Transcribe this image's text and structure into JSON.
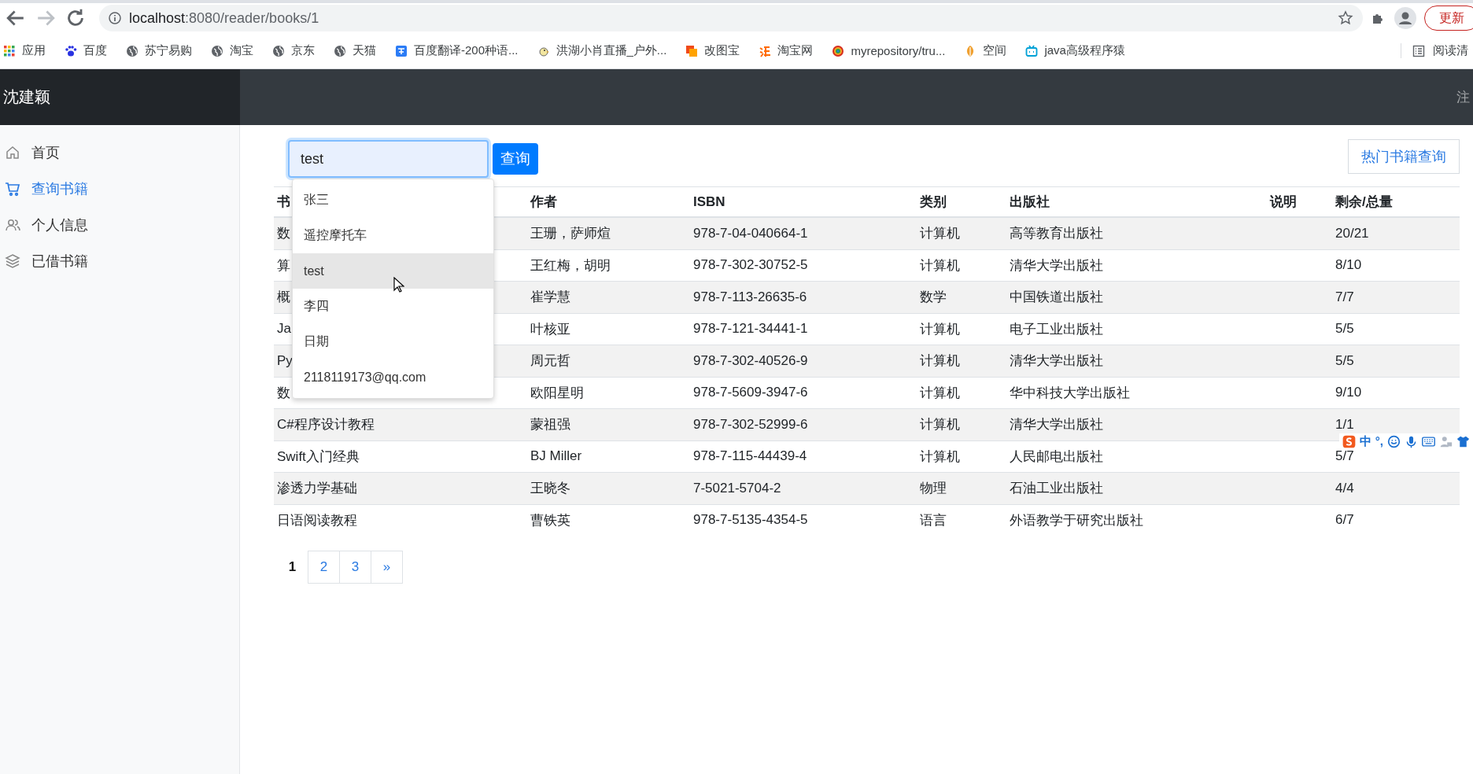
{
  "browser": {
    "url": {
      "host": "localhost",
      "path": ":8080/reader/books/1"
    },
    "update_button": "更新",
    "bookmarks": [
      {
        "kind": "apps",
        "label": "应用"
      },
      {
        "kind": "paw",
        "label": "百度"
      },
      {
        "kind": "globe",
        "label": "苏宁易购"
      },
      {
        "kind": "globe",
        "label": "淘宝"
      },
      {
        "kind": "globe",
        "label": "京东"
      },
      {
        "kind": "globe",
        "label": "天猫"
      },
      {
        "kind": "translate",
        "label": "百度翻译-200种语..."
      },
      {
        "kind": "bird",
        "label": "洪湖小肖直播_户外..."
      },
      {
        "kind": "squares",
        "label": "改图宝"
      },
      {
        "kind": "tao",
        "label": "淘宝网"
      },
      {
        "kind": "ring",
        "label": "myrepository/tru..."
      },
      {
        "kind": "leaf",
        "label": "空间"
      },
      {
        "kind": "tv",
        "label": "java高级程序猿"
      }
    ],
    "reading_list": "阅读清"
  },
  "header": {
    "brand": "沈建颖",
    "logout": "注"
  },
  "sidebar": {
    "items": [
      {
        "label": "首页",
        "selected": false
      },
      {
        "label": "查询书籍",
        "selected": true
      },
      {
        "label": "个人信息",
        "selected": false
      },
      {
        "label": "已借书籍",
        "selected": false
      }
    ]
  },
  "search": {
    "value": "test",
    "button": "查询",
    "suggestions": [
      {
        "text": "张三",
        "highlighted": false
      },
      {
        "text": "遥控摩托车",
        "highlighted": false
      },
      {
        "text": "test",
        "highlighted": true
      },
      {
        "text": "李四",
        "highlighted": false
      },
      {
        "text": "日期",
        "highlighted": false
      },
      {
        "text": "2118119173@qq.com",
        "highlighted": false
      }
    ]
  },
  "hot_books_button": "热门书籍查询",
  "table": {
    "columns": [
      "书",
      "作者",
      "ISBN",
      "类别",
      "出版社",
      "说明",
      "剩余/总量"
    ],
    "rows": [
      [
        "数",
        "王珊，萨师煊",
        "978-7-04-040664-1",
        "计算机",
        "高等教育出版社",
        "",
        "20/21"
      ],
      [
        "算",
        "王红梅，胡明",
        "978-7-302-30752-5",
        "计算机",
        "清华大学出版社",
        "",
        "8/10"
      ],
      [
        "概",
        "崔学慧",
        "978-7-113-26635-6",
        "数学",
        "中国铁道出版社",
        "",
        "7/7"
      ],
      [
        "Ja",
        "叶核亚",
        "978-7-121-34441-1",
        "计算机",
        "电子工业出版社",
        "",
        "5/5"
      ],
      [
        "Py",
        "周元哲",
        "978-7-302-40526-9",
        "计算机",
        "清华大学出版社",
        "",
        "5/5"
      ],
      [
        "数",
        "欧阳星明",
        "978-7-5609-3947-6",
        "计算机",
        "华中科技大学出版社",
        "",
        "9/10"
      ],
      [
        "C#程序设计教程",
        "蒙祖强",
        "978-7-302-52999-6",
        "计算机",
        "清华大学出版社",
        "",
        "1/1"
      ],
      [
        "Swift入门经典",
        "BJ Miller",
        "978-7-115-44439-4",
        "计算机",
        "人民邮电出版社",
        "",
        "5/7"
      ],
      [
        "渗透力学基础",
        "王晓冬",
        "7-5021-5704-2",
        "物理",
        "石油工业出版社",
        "",
        "4/4"
      ],
      [
        "日语阅读教程",
        "曹铁英",
        "978-7-5135-4354-5",
        "语言",
        "外语教学于研究出版社",
        "",
        "6/7"
      ]
    ]
  },
  "pagination": [
    {
      "label": "1",
      "selected": true
    },
    {
      "label": "2",
      "selected": false
    },
    {
      "label": "3",
      "selected": false
    },
    {
      "label": "»",
      "selected": false
    }
  ],
  "ime_toolbar": {
    "labels": [
      "中",
      "°,"
    ]
  }
}
